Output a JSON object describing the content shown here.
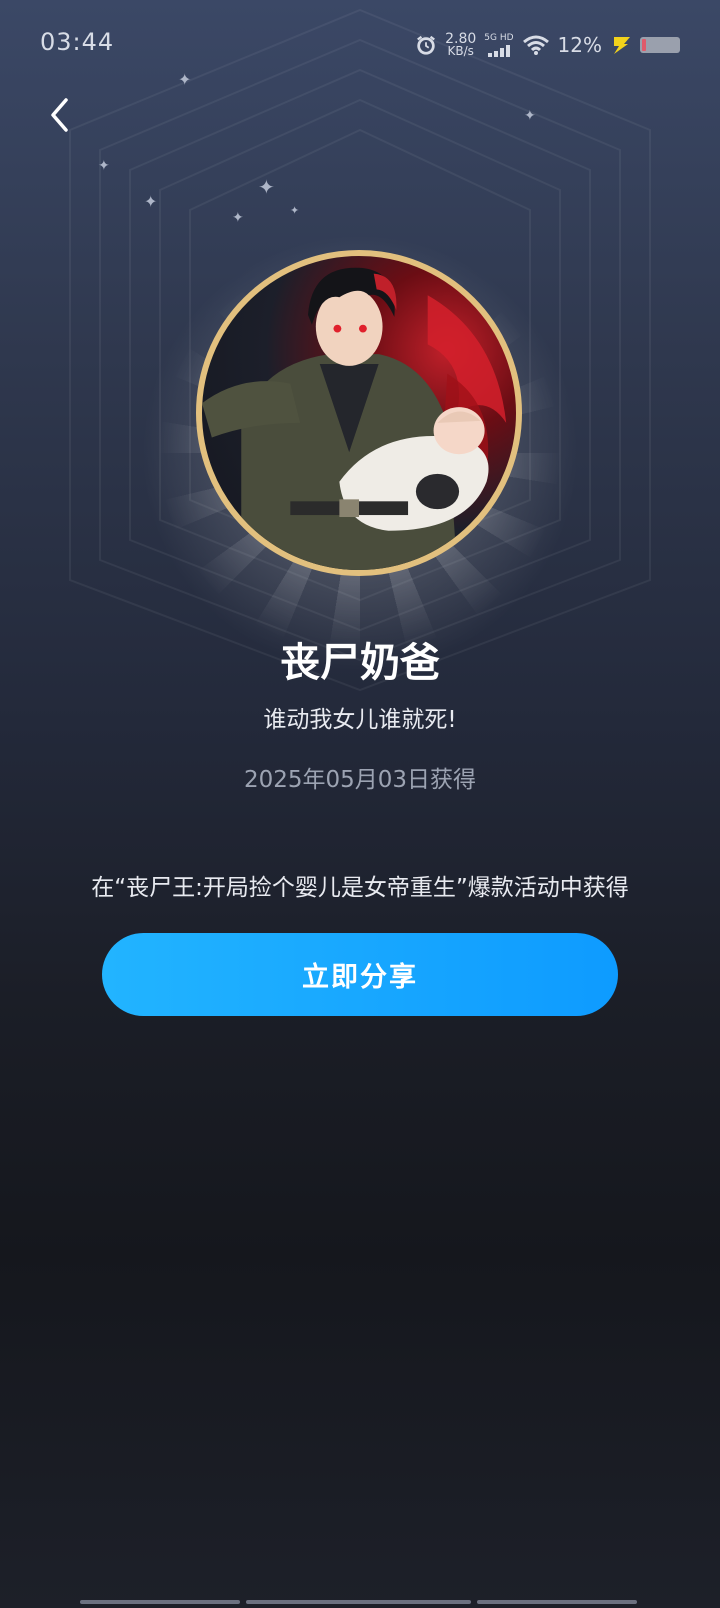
{
  "status_bar": {
    "time": "03:44",
    "net_speed_value": "2.80",
    "net_speed_unit": "KB/s",
    "network_label": "5G HD",
    "battery_percent": "12%",
    "icons": [
      "alarm-icon",
      "signal-icon",
      "wifi-icon",
      "charge-icon",
      "battery-icon"
    ]
  },
  "header": {
    "back_icon": "chevron-left-icon"
  },
  "badge": {
    "title": "丧尸奶爸",
    "subtitle": "谁动我女儿谁就死!",
    "date": "2025年05月03日获得",
    "description": "在“丧尸王:开局捡个婴儿是女帝重生”爆款活动中获得",
    "frame_color": "#e2c07e"
  },
  "actions": {
    "share_label": "立即分享",
    "share_color": "#22b4ff"
  }
}
